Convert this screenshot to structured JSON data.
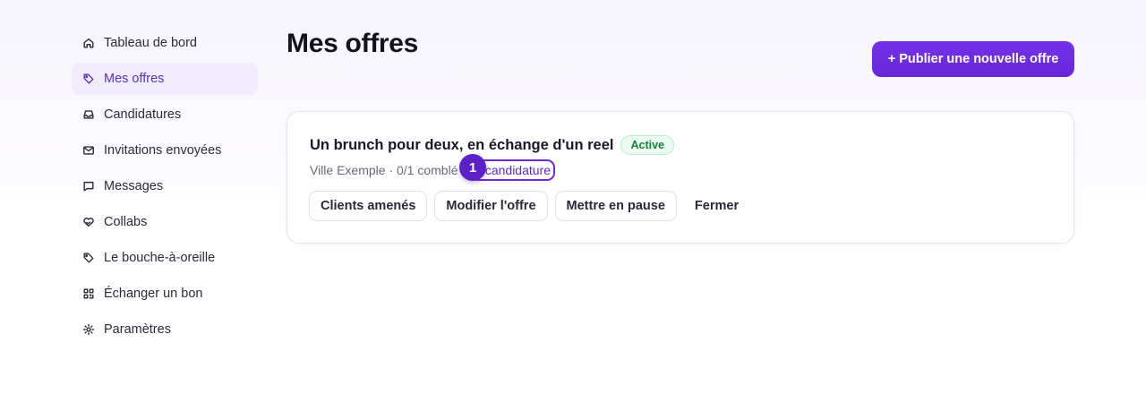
{
  "sidebar": {
    "items": [
      {
        "label": "Tableau de bord",
        "icon": "home-icon"
      },
      {
        "label": "Mes offres",
        "icon": "tag-icon",
        "active": true
      },
      {
        "label": "Candidatures",
        "icon": "inbox-icon"
      },
      {
        "label": "Invitations envoyées",
        "icon": "mail-icon"
      },
      {
        "label": "Messages",
        "icon": "message-icon"
      },
      {
        "label": "Collabs",
        "icon": "handshake-icon"
      },
      {
        "label": "Le bouche-à-oreille",
        "icon": "tag-icon"
      },
      {
        "label": "Échanger un bon",
        "icon": "qr-code-icon"
      },
      {
        "label": "Paramètres",
        "icon": "gear-icon"
      }
    ]
  },
  "header": {
    "title": "Mes offres",
    "publish_label": "+ Publier une nouvelle offre"
  },
  "offer": {
    "title": "Un brunch pour deux, en échange d'un reel",
    "status": "Active",
    "meta": "Ville Exemple · 0/1 comblé",
    "separator": "·",
    "applications_link": "0 candidature",
    "step_marker": "1",
    "actions": {
      "clients": "Clients amenés",
      "edit": "Modifier l'offre",
      "pause": "Mettre en pause",
      "close": "Fermer"
    }
  },
  "colors": {
    "accent": "#6d28d9",
    "active_nav_bg": "#f1edfc",
    "status_green": "#15803d"
  }
}
